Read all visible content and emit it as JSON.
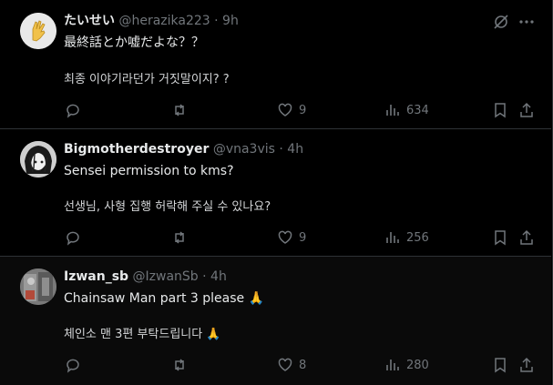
{
  "posts": [
    {
      "name": "たいせい",
      "handle": "@herazika223",
      "sep": "·",
      "time": "9h",
      "text": "最終話とか嘘だよな？？",
      "translation": "최종 이야기라던가 거짓말이지? ?",
      "likes": "9",
      "views": "634",
      "replies": "",
      "reposts": ""
    },
    {
      "name": "Bigmotherdestroyer",
      "handle": "@vna3vis",
      "sep": "·",
      "time": "4h",
      "text": "Sensei permission to kms?",
      "translation": "선생님, 사형 집행 허락해 주실 수 있나요?",
      "likes": "9",
      "views": "256",
      "replies": "",
      "reposts": ""
    },
    {
      "name": "Izwan_sb",
      "handle": "@IzwanSb",
      "sep": "·",
      "time": "4h",
      "text": "Chainsaw Man part 3 please 🙏",
      "translation": "체인소 맨 3편 부탁드립니다 🙏",
      "likes": "8",
      "views": "280",
      "replies": "",
      "reposts": ""
    }
  ],
  "icons": {
    "reply": "reply-icon",
    "repost": "repost-icon",
    "like": "heart-icon",
    "views": "views-icon",
    "bookmark": "bookmark-icon",
    "share": "share-icon",
    "grok": "grok-icon",
    "more": "more-icon"
  },
  "colors": {
    "background": "#000000",
    "text": "#e7e9ea",
    "muted": "#71767b",
    "border": "#2f3336"
  }
}
